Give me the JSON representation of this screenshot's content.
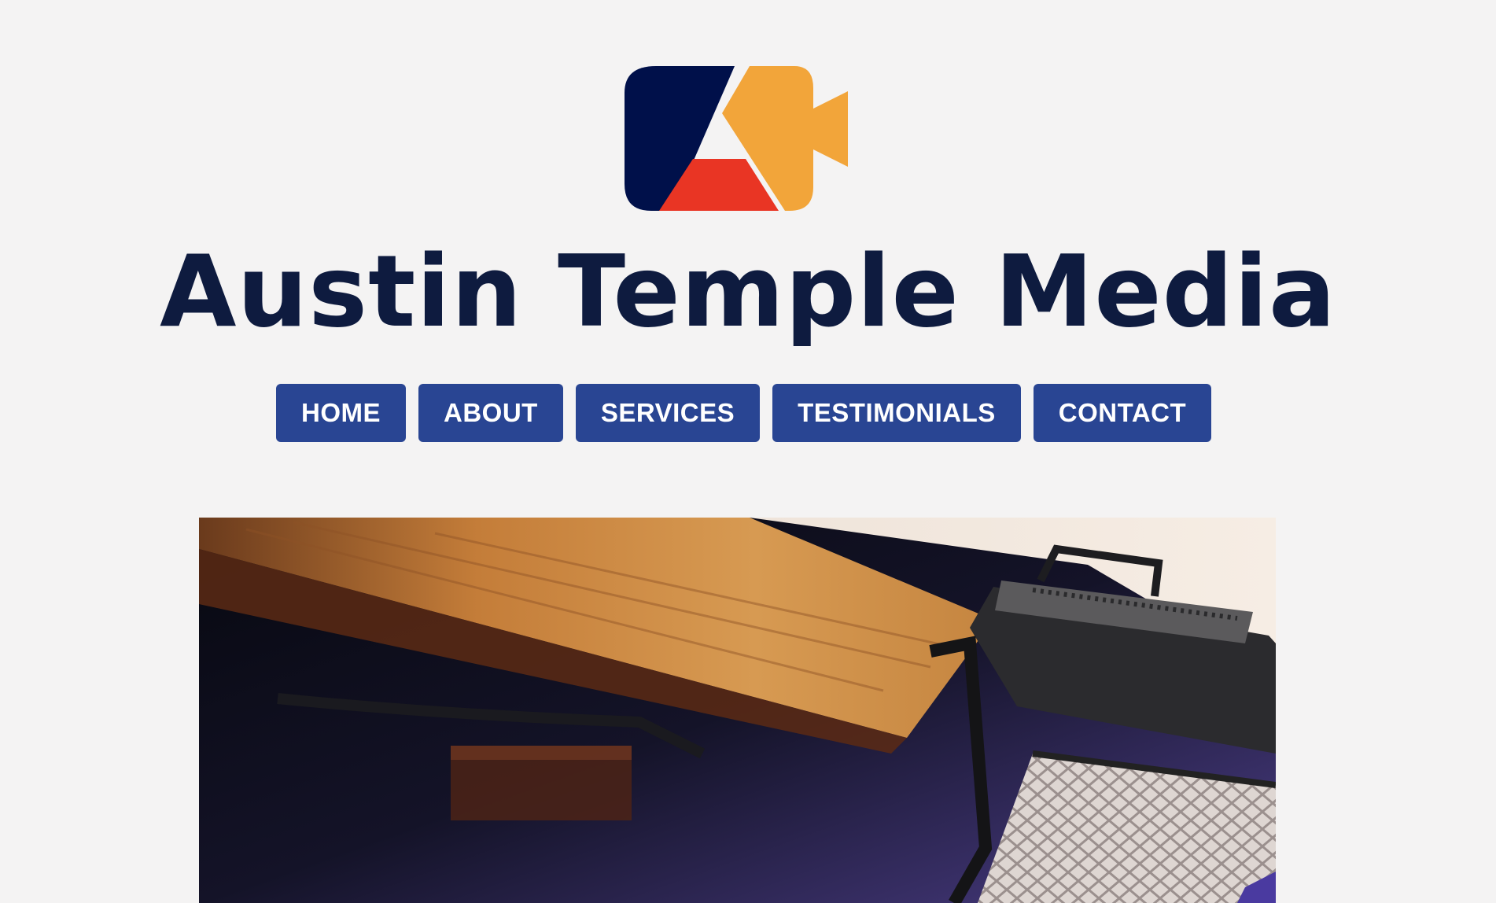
{
  "brand": {
    "logo_icon": "camera-a-logo-icon",
    "title": "Austin Temple Media",
    "colors": {
      "navy": "#0e1b3f",
      "logo_navy": "#00104a",
      "orange": "#f2a53a",
      "red": "#e93524",
      "nav_blue": "#294593",
      "background": "#f4f3f3"
    }
  },
  "nav": {
    "items": [
      {
        "label": "HOME"
      },
      {
        "label": "ABOUT"
      },
      {
        "label": "SERVICES"
      },
      {
        "label": "TESTIMONIALS"
      },
      {
        "label": "CONTACT"
      }
    ]
  },
  "hero": {
    "image": "studio-light-softbox-photo"
  }
}
